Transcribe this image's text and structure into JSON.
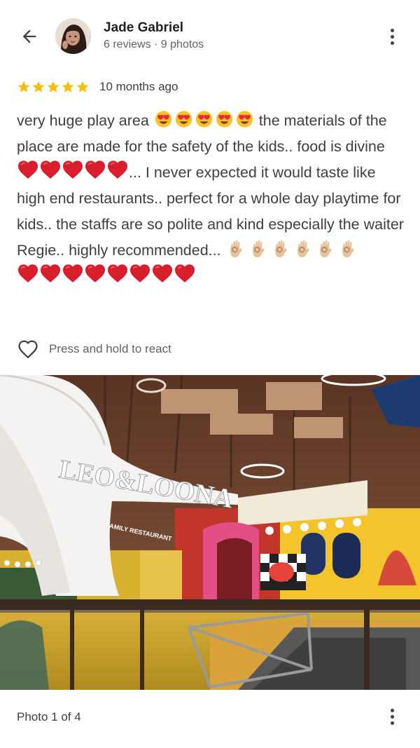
{
  "header": {
    "back_icon": "arrow-left-icon",
    "reviewer_name": "Jade Gabriel",
    "reviewer_meta": "6 reviews · 9 photos",
    "more_icon": "more-vert-icon"
  },
  "review": {
    "rating": 5,
    "max_rating": 5,
    "star_color": "#fbbc04",
    "time_ago": "10 months ago",
    "text_segments": {
      "s1": "very huge play area ",
      "s2": " the materials of the place are made for the safety of the kids.. food is divine",
      "s3": "... I never expected it would taste like high end restaurants.. perfect for a whole day playtime for kids.. the staffs are so polite and kind especially the waiter Regie.. highly recommended... "
    },
    "emoji": {
      "heart_eyes_count": 5,
      "red_heart_count_1": 5,
      "ok_hand_count": 6,
      "red_heart_count_2": 8
    }
  },
  "react": {
    "icon": "heart-outline-icon",
    "label": "Press and hold to react"
  },
  "photo": {
    "sign_text": "LEO&LOONA",
    "sub_sign": "FAMILY RESTAURANT"
  },
  "footer": {
    "counter": "Photo 1 of 4",
    "more_icon": "more-vert-icon"
  }
}
